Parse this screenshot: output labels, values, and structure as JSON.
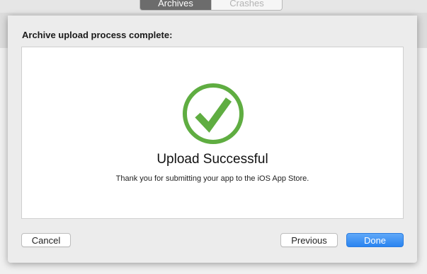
{
  "toolbar": {
    "tabs": [
      {
        "label": "Archives",
        "selected": true
      },
      {
        "label": "Crashes",
        "selected": false
      }
    ]
  },
  "dialog": {
    "title": "Archive upload process complete:",
    "status_icon": "checkmark-circle-icon",
    "heading": "Upload Successful",
    "message": "Thank you for submitting your app to the iOS App Store.",
    "buttons": {
      "cancel": "Cancel",
      "previous": "Previous",
      "done": "Done"
    }
  },
  "colors": {
    "success_green": "#5fad41",
    "accent_blue": "#2a84f0"
  }
}
